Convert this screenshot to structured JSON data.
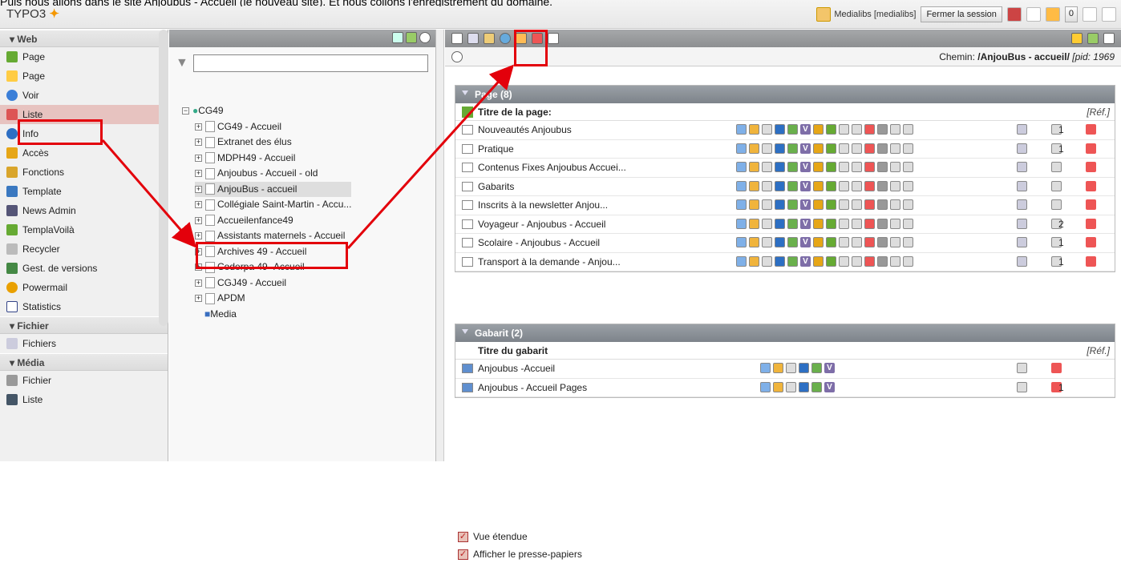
{
  "caption": "Puis nous allons dans le site Anjoubus - Accueil (le nouveau site). Et nous collons l'enregistrement du domaine.",
  "logo": "TYPO3",
  "user": "Medialibs [medialibs]",
  "logout": "Fermer la session",
  "counter": "0",
  "sidebar": {
    "web": "Web",
    "items": [
      "Page",
      "Page",
      "Voir",
      "Liste",
      "Info",
      "Accès",
      "Fonctions",
      "Template",
      "News Admin",
      "TemplaVoilà",
      "Recycler",
      "Gest. de versions",
      "Powermail",
      "Statistics"
    ],
    "fichier": "Fichier",
    "fichier_items": [
      "Fichiers"
    ],
    "media": "Média",
    "media_items": [
      "Fichier",
      "Liste"
    ]
  },
  "tree": {
    "root": "CG49",
    "nodes": [
      "CG49 - Accueil",
      "Extranet des élus",
      "MDPH49 - Accueil",
      "Anjoubus - Accueil - old",
      "AnjouBus - accueil",
      "Collégiale Saint-Martin - Accu...",
      "Accueilenfance49",
      "Assistants maternels - Accueil",
      "Archives 49 - Accueil",
      "Coderpa 49 -Accueil",
      "CGJ49 - Accueil",
      "APDM",
      "Media"
    ]
  },
  "main": {
    "path_label": "Chemin:",
    "path": "/AnjouBus - accueil/",
    "pid": "[pid: 1969",
    "page_panel": "Page (8)",
    "page_header": "Titre de la page:",
    "ref": "[Réf.]",
    "rows": [
      "Nouveautés Anjoubus",
      "Pratique",
      "Contenus Fixes Anjoubus Accuei...",
      "Gabarits",
      "Inscrits à la newsletter Anjou...",
      "Voyageur - Anjoubus - Accueil",
      "Scolaire - Anjoubus - Accueil",
      "Transport à la demande - Anjou..."
    ],
    "counts": [
      "1",
      "1",
      "",
      "",
      "",
      "2",
      "1",
      "1"
    ],
    "gab_panel": "Gabarit (2)",
    "gab_header": "Titre du gabarit",
    "gab_rows": [
      "Anjoubus -Accueil",
      "Anjoubus - Accueil Pages"
    ],
    "gab_counts": [
      "",
      "1"
    ],
    "check1": "Vue étendue",
    "check2": "Afficher le presse-papiers"
  }
}
